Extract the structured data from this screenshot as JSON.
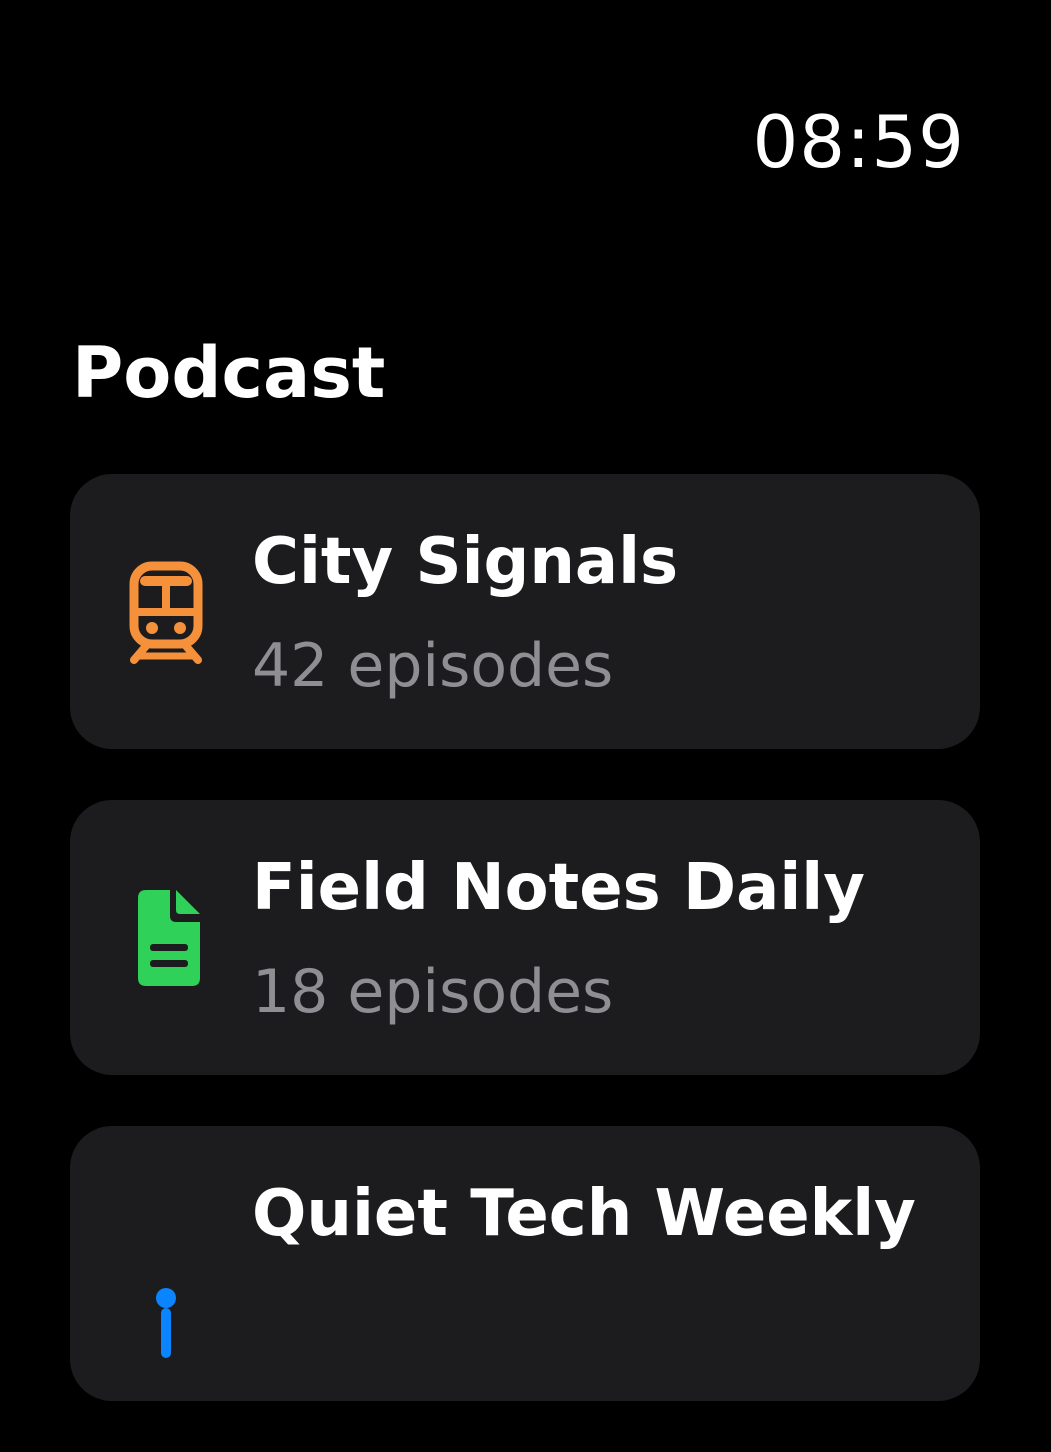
{
  "status": {
    "time": "08:59"
  },
  "header": {
    "title": "Podcast"
  },
  "podcasts": [
    {
      "title": "City Signals",
      "subtitle": "42 episodes",
      "icon": "tram-icon",
      "icon_color": "#f6913b"
    },
    {
      "title": "Field Notes Daily",
      "subtitle": "18 episodes",
      "icon": "document-icon",
      "icon_color": "#30d158"
    },
    {
      "title": "Quiet Tech Weekly",
      "icon": "podcast-icon",
      "icon_color": "#0a84ff"
    }
  ]
}
